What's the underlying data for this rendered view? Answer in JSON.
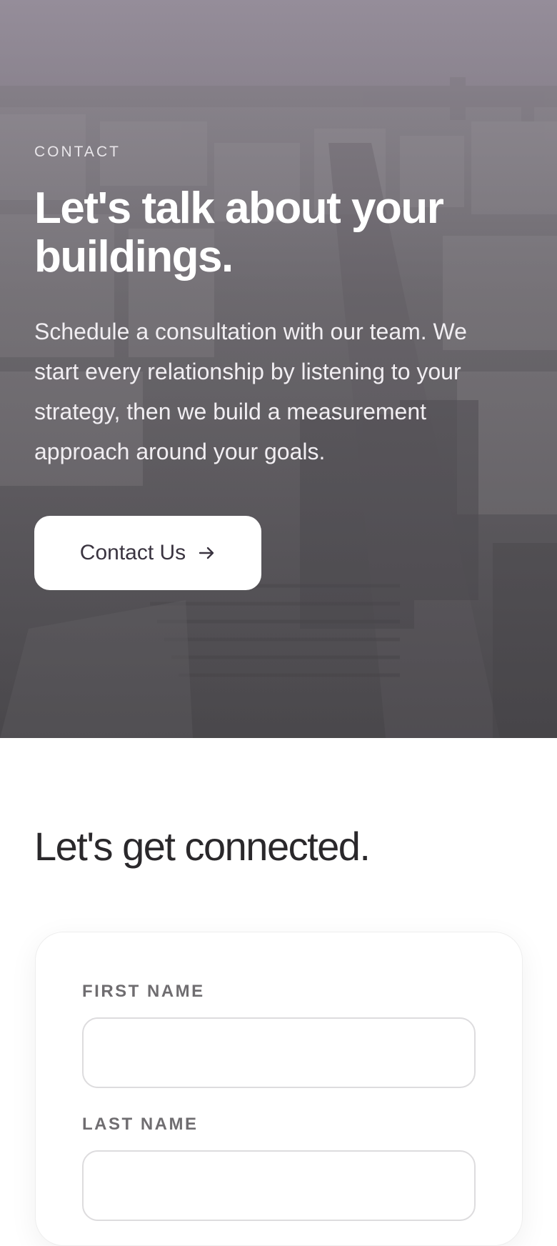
{
  "hero": {
    "eyebrow": "CONTACT",
    "title": "Let's talk about your buildings.",
    "text": "Schedule a consultation with our team. We start every relationship by listening to your strategy, then we build a measurement approach around your goals.",
    "cta_label": "Contact Us",
    "cta_icon": "arrow-right-icon",
    "background": "aerial-city-photo"
  },
  "connect": {
    "title": "Let's get connected."
  },
  "form": {
    "first_name_label": "FIRST NAME",
    "first_name_value": "",
    "last_name_label": "LAST NAME",
    "last_name_value": ""
  },
  "colors": {
    "hero_overlay": "#6f6b70",
    "button_bg": "#ffffff",
    "button_text": "#3a3440",
    "heading": "#2a282b",
    "label": "#6f6d70",
    "input_border": "#dddcde"
  }
}
